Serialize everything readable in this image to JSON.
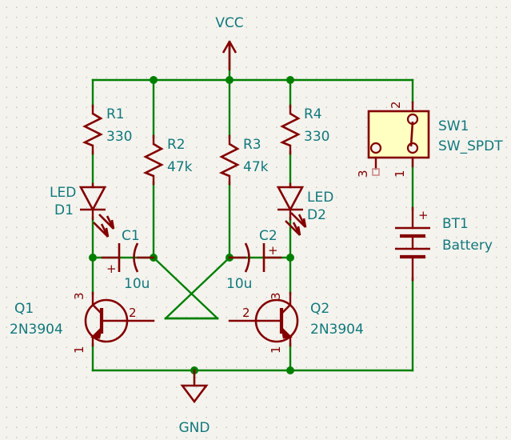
{
  "sheet": {
    "title": "Astable Multivibrator Schematic",
    "background": "#f4f3ee",
    "wire_color": "#008000",
    "component_color": "#840000",
    "label_color": "#11797d",
    "body_fill": "#ffffc2"
  },
  "power_ports": [
    {
      "id": "vcc",
      "label": "VCC",
      "type": "power-arrow-up"
    },
    {
      "id": "gnd",
      "label": "GND",
      "type": "ground-triangle"
    }
  ],
  "components": [
    {
      "ref": "R1",
      "value": "330",
      "type": "resistor"
    },
    {
      "ref": "R2",
      "value": "47k",
      "type": "resistor"
    },
    {
      "ref": "R3",
      "value": "47k",
      "type": "resistor"
    },
    {
      "ref": "R4",
      "value": "330",
      "type": "resistor"
    },
    {
      "ref": "D1",
      "value": "LED",
      "type": "led"
    },
    {
      "ref": "D2",
      "value": "LED",
      "type": "led"
    },
    {
      "ref": "C1",
      "value": "10u",
      "type": "capacitor-polarized",
      "polarity_mark": "+"
    },
    {
      "ref": "C2",
      "value": "10u",
      "type": "capacitor-polarized",
      "polarity_mark": "+"
    },
    {
      "ref": "Q1",
      "value": "2N3904",
      "type": "transistor-npn",
      "pins": [
        "1",
        "2",
        "3"
      ]
    },
    {
      "ref": "Q2",
      "value": "2N3904",
      "type": "transistor-npn",
      "pins": [
        "1",
        "2",
        "3"
      ]
    },
    {
      "ref": "SW1",
      "value": "SW_SPDT",
      "type": "switch-spdt",
      "pins": [
        "1",
        "2",
        "3"
      ]
    },
    {
      "ref": "BT1",
      "value": "Battery",
      "type": "battery",
      "polarity_mark": "+"
    }
  ],
  "labels": {
    "r1_ref": "R1",
    "r1_val": "330",
    "r2_ref": "R2",
    "r2_val": "47k",
    "r3_ref": "R3",
    "r3_val": "47k",
    "r4_ref": "R4",
    "r4_val": "330",
    "d1_val": "LED",
    "d1_ref": "D1",
    "d2_val": "LED",
    "d2_ref": "D2",
    "c1_ref": "C1",
    "c1_val": "10u",
    "c1_plus": "+",
    "c2_ref": "C2",
    "c2_val": "10u",
    "c2_plus": "+",
    "q1_ref": "Q1",
    "q1_val": "2N3904",
    "q2_ref": "Q2",
    "q2_val": "2N3904",
    "sw1_ref": "SW1",
    "sw1_val": "SW_SPDT",
    "bt1_ref": "BT1",
    "bt1_val": "Battery",
    "bt1_plus": "+",
    "vcc": "VCC",
    "gnd": "GND",
    "q1_pin1": "1",
    "q1_pin2": "2",
    "q1_pin3": "3",
    "q2_pin1": "1",
    "q2_pin2": "2",
    "q2_pin3": "3",
    "sw1_pin1": "1",
    "sw1_pin2": "2",
    "sw1_pin3": "3"
  }
}
